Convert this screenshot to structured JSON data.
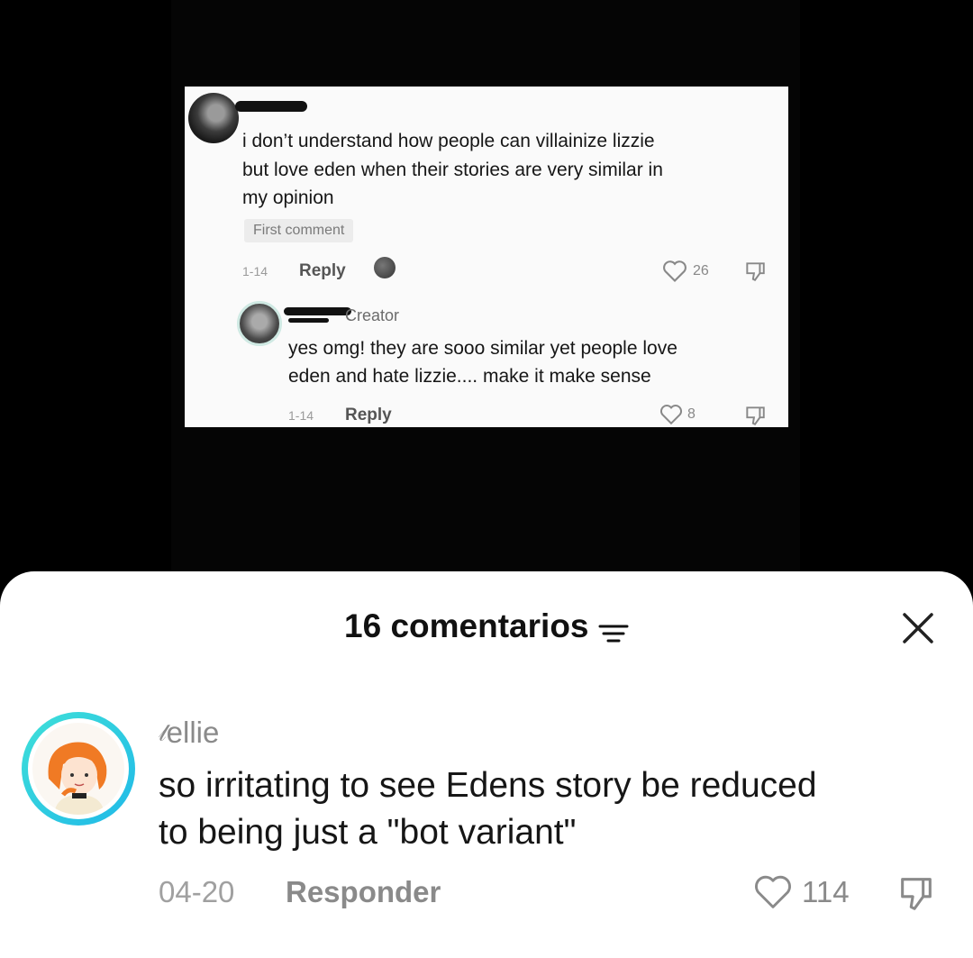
{
  "video": {
    "comment1": {
      "lines": [
        "i don’t understand how people can villainize lizzie",
        "but love eden when their stories are very similar in",
        "my opinion"
      ],
      "badge": "First comment",
      "date": "1-14",
      "reply_label": "Reply",
      "likes": "26"
    },
    "comment2": {
      "creator_label": "Creator",
      "lines": [
        "yes omg! they are sooo similar yet people love",
        "eden and hate lizzie.... make it make sense"
      ],
      "date": "1-14",
      "reply_label": "Reply",
      "likes": "8"
    }
  },
  "sheet": {
    "title": "16 comentarios",
    "filter_icon": "filter-lines-icon",
    "close_icon": "close-icon"
  },
  "comment": {
    "username": "ellie",
    "text_line1": "so irritating to see Edens story be reduced",
    "text_line2": "to being just a \"bot variant\"",
    "date": "04-20",
    "reply_label": "Responder",
    "likes": "114",
    "avatar_ring_color": "#2ec9e6"
  }
}
